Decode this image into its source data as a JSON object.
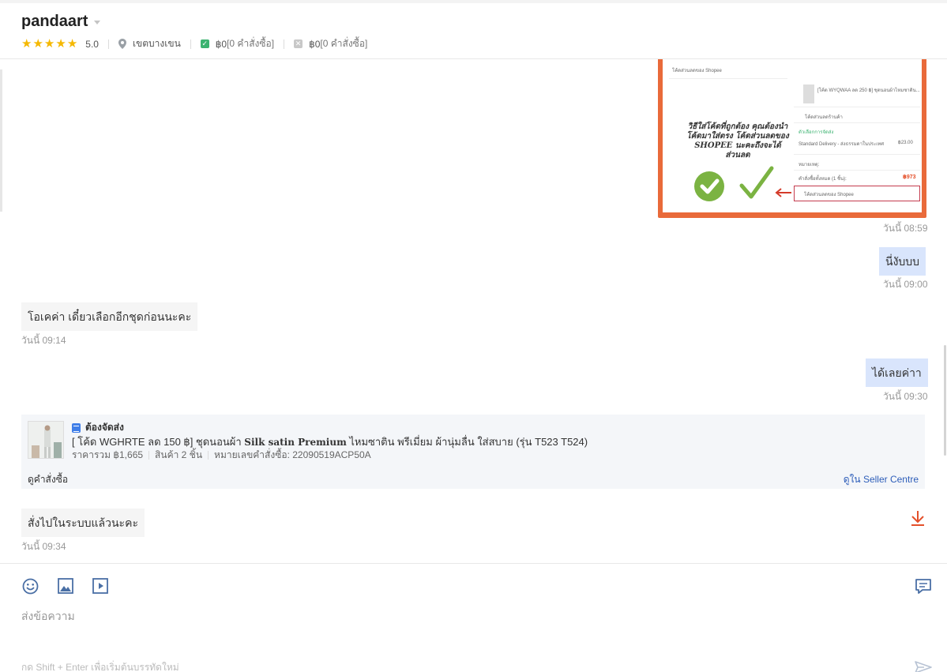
{
  "header": {
    "shop_name": "pandaart",
    "rating": "5.0",
    "location": "เขตบางเขน",
    "orders_completed": "฿0",
    "orders_completed_count": "[0 คำสั่งซื้อ]",
    "orders_cancelled": "฿0",
    "orders_cancelled_count": "[0 คำสั่งซื้อ]",
    "star_color": "#f5b800"
  },
  "shared_image": {
    "promo_text": "วิธีใส่โค้ดที่ถูกต้อง คุณต้องนำโค้ดมาใส่ตรง โค้ดส่วนลดของ SHOPEE นะคะถึงจะได้ส่วนลด",
    "voucher_label": "โค้ดส่วนลดของ Shopee",
    "product_text": "[โค้ด WYQWAA ลด 250 ฿] ชุดนอนผ้าไหมซาติน...",
    "shop_voucher": "โค้ดส่วนลดร้านค้า",
    "shipping_option": "ตัวเลือกการจัดส่ง",
    "delivery": "Standard Delivery - ส่งธรรมดาในประเทศ",
    "delivery_price": "฿23.00",
    "note_label": "หมายเหตุ:",
    "total_label": "คำสั่งซื้อทั้งหมด (1 ชิ้น):",
    "total_price": "฿973"
  },
  "messages": [
    {
      "text": "",
      "time": "วันนี้ 08:59"
    },
    {
      "text": "นี่งับบบ",
      "time": "วันนี้ 09:00"
    },
    {
      "text": "โอเคค่า เดี๋ยวเลือกอีกชุดก่อนนะคะ",
      "time": "วันนี้ 09:14"
    },
    {
      "text": "ได้เลยค่าา",
      "time": "วันนี้ 09:30"
    },
    {
      "text": "สั่งไปในระบบแล้วนะคะ",
      "time": "วันนี้ 09:34"
    }
  ],
  "order": {
    "status": "ต้องจัดส่ง",
    "product_prefix": "[ โค้ด WGHRTE ลด 150 ฿] ชุดนอนผ้า ",
    "product_bold": "Silk satin Premium",
    "product_suffix": " ไหมซาติน พรีเมี่ยม ผ้านุ่มลื่น ใส่สบาย (รุ่น T523 T524)",
    "total": "ราคารวม ฿1,665",
    "items": "สินค้า 2 ชิ้น",
    "order_no": "หมายเลขคำสั่งซื้อ: 22090519ACP50A",
    "view_order": "ดูคำสั่งซื้อ",
    "view_seller": "ดูใน Seller Centre"
  },
  "composer": {
    "placeholder": "ส่งข้อความ",
    "hint": "กด Shift + Enter เพื่อเริ่มต้นบรรทัดใหม่"
  }
}
